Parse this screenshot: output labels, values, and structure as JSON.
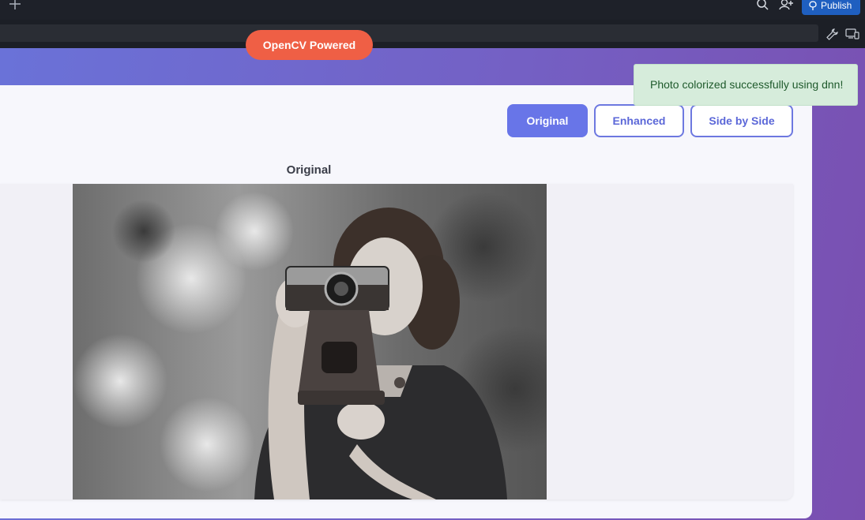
{
  "topbar": {
    "publish_label": "Publish"
  },
  "app": {
    "banner_pill": "OpenCV Powered",
    "view_buttons": {
      "original": "Original",
      "enhanced": "Enhanced",
      "side_by_side": "Side by Side"
    },
    "panel_title": "Original",
    "image_alt": "Black and white portrait of a woman holding a vintage camera to her eye",
    "active_view": "Original"
  },
  "toast": {
    "message": "Photo colorized successfully using dnn!"
  },
  "colors": {
    "accent": "#6875e8",
    "pill": "#ef5f45",
    "toast_bg": "#d6ecdb",
    "publish": "#1f5fc0"
  }
}
